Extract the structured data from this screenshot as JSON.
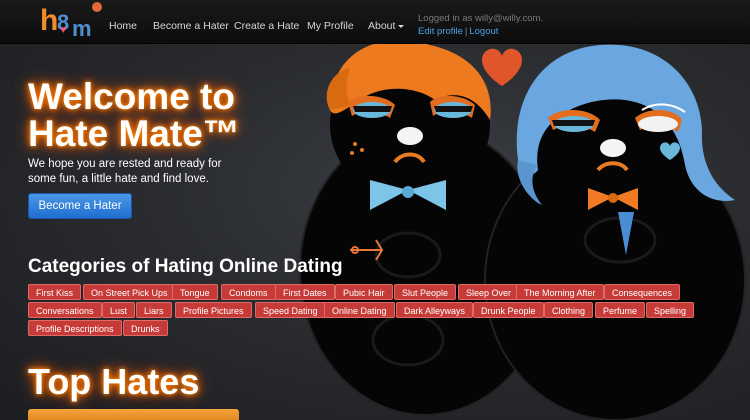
{
  "brand": {
    "logo_h": "h",
    "logo_8": "8",
    "logo_m": "m"
  },
  "nav": {
    "items": [
      {
        "label": "Home"
      },
      {
        "label": "Become a Hater"
      },
      {
        "label": "Create a Hate"
      },
      {
        "label": "My Profile"
      },
      {
        "label": "About"
      }
    ],
    "logged_in_text": "Logged in as willy@willy.com.",
    "edit_profile": "Edit profile",
    "separator": "|",
    "logout": "Logout"
  },
  "hero": {
    "title": "Welcome to Hate Mate™",
    "subtitle": "We hope you are rested and ready for some fun, a little hate and find love.",
    "cta": "Become a Hater"
  },
  "categories": {
    "heading": "Categories of Hating Online Dating",
    "tags": [
      "First Kiss",
      "On Street Pick Ups",
      "Tongue",
      "Condoms",
      "First Dates",
      "Pubic Hair",
      "Slut People",
      "Sleep Over",
      "The Morning After",
      "Consequences",
      "Conversations",
      "Lust",
      "Liars",
      "Profile Pictures",
      "Speed Dating",
      "Online Dating",
      "Dark Alleyways",
      "Drunk People",
      "Clothing",
      "Perfume",
      "Spelling",
      "Profile Descriptions",
      "Drunks"
    ]
  },
  "top_hates": {
    "title": "Top Hates"
  },
  "colors": {
    "accent_orange": "#ff7a00",
    "tag_red": "#c63b37",
    "button_blue": "#2a7bd8",
    "link_blue": "#4aa3e8"
  }
}
